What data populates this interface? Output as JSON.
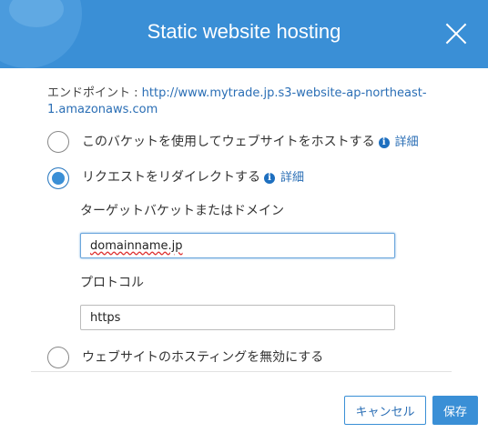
{
  "dialog": {
    "title": "Static website hosting",
    "endpoint_label": "エンドポイント : ",
    "endpoint_url": "http://www.mytrade.jp.s3-website-ap-northeast-1.amazonaws.com",
    "accent_color": "#3a8fd6"
  },
  "options": [
    {
      "label": "このバケットを使用してウェブサイトをホストする",
      "detail": "詳細",
      "selected": false
    },
    {
      "label": "リクエストをリダイレクトする",
      "detail": "詳細",
      "selected": true
    },
    {
      "label": "ウェブサイトのホスティングを無効にする",
      "selected": false
    }
  ],
  "redirect": {
    "target_label": "ターゲットバケットまたはドメイン",
    "target_value": "domainname.jp",
    "protocol_label": "プロトコル",
    "protocol_value": "https"
  },
  "buttons": {
    "cancel": "キャンセル",
    "save": "保存"
  }
}
